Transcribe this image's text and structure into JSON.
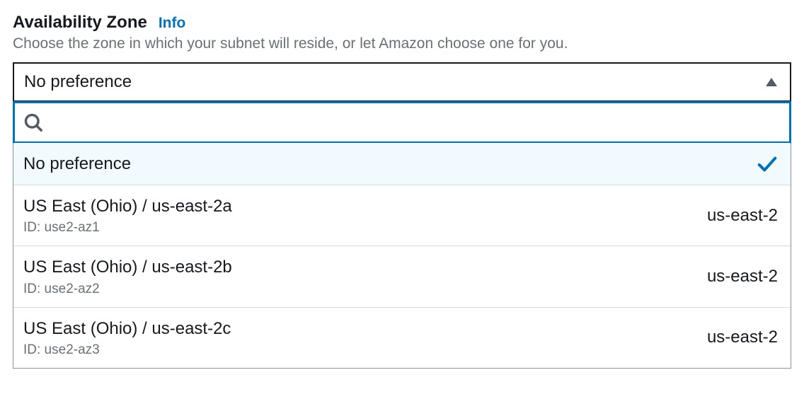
{
  "field": {
    "label": "Availability Zone",
    "info": "Info",
    "description": "Choose the zone in which your subnet will reside, or let Amazon choose one for you."
  },
  "select": {
    "current": "No preference"
  },
  "search": {
    "placeholder": ""
  },
  "options": [
    {
      "primary": "No preference",
      "secondary": "",
      "right": "",
      "selected": true
    },
    {
      "primary": "US East (Ohio) / us-east-2a",
      "secondary": "ID: use2-az1",
      "right": "us-east-2",
      "selected": false
    },
    {
      "primary": "US East (Ohio) / us-east-2b",
      "secondary": "ID: use2-az2",
      "right": "us-east-2",
      "selected": false
    },
    {
      "primary": "US East (Ohio) / us-east-2c",
      "secondary": "ID: use2-az3",
      "right": "us-east-2",
      "selected": false
    }
  ]
}
